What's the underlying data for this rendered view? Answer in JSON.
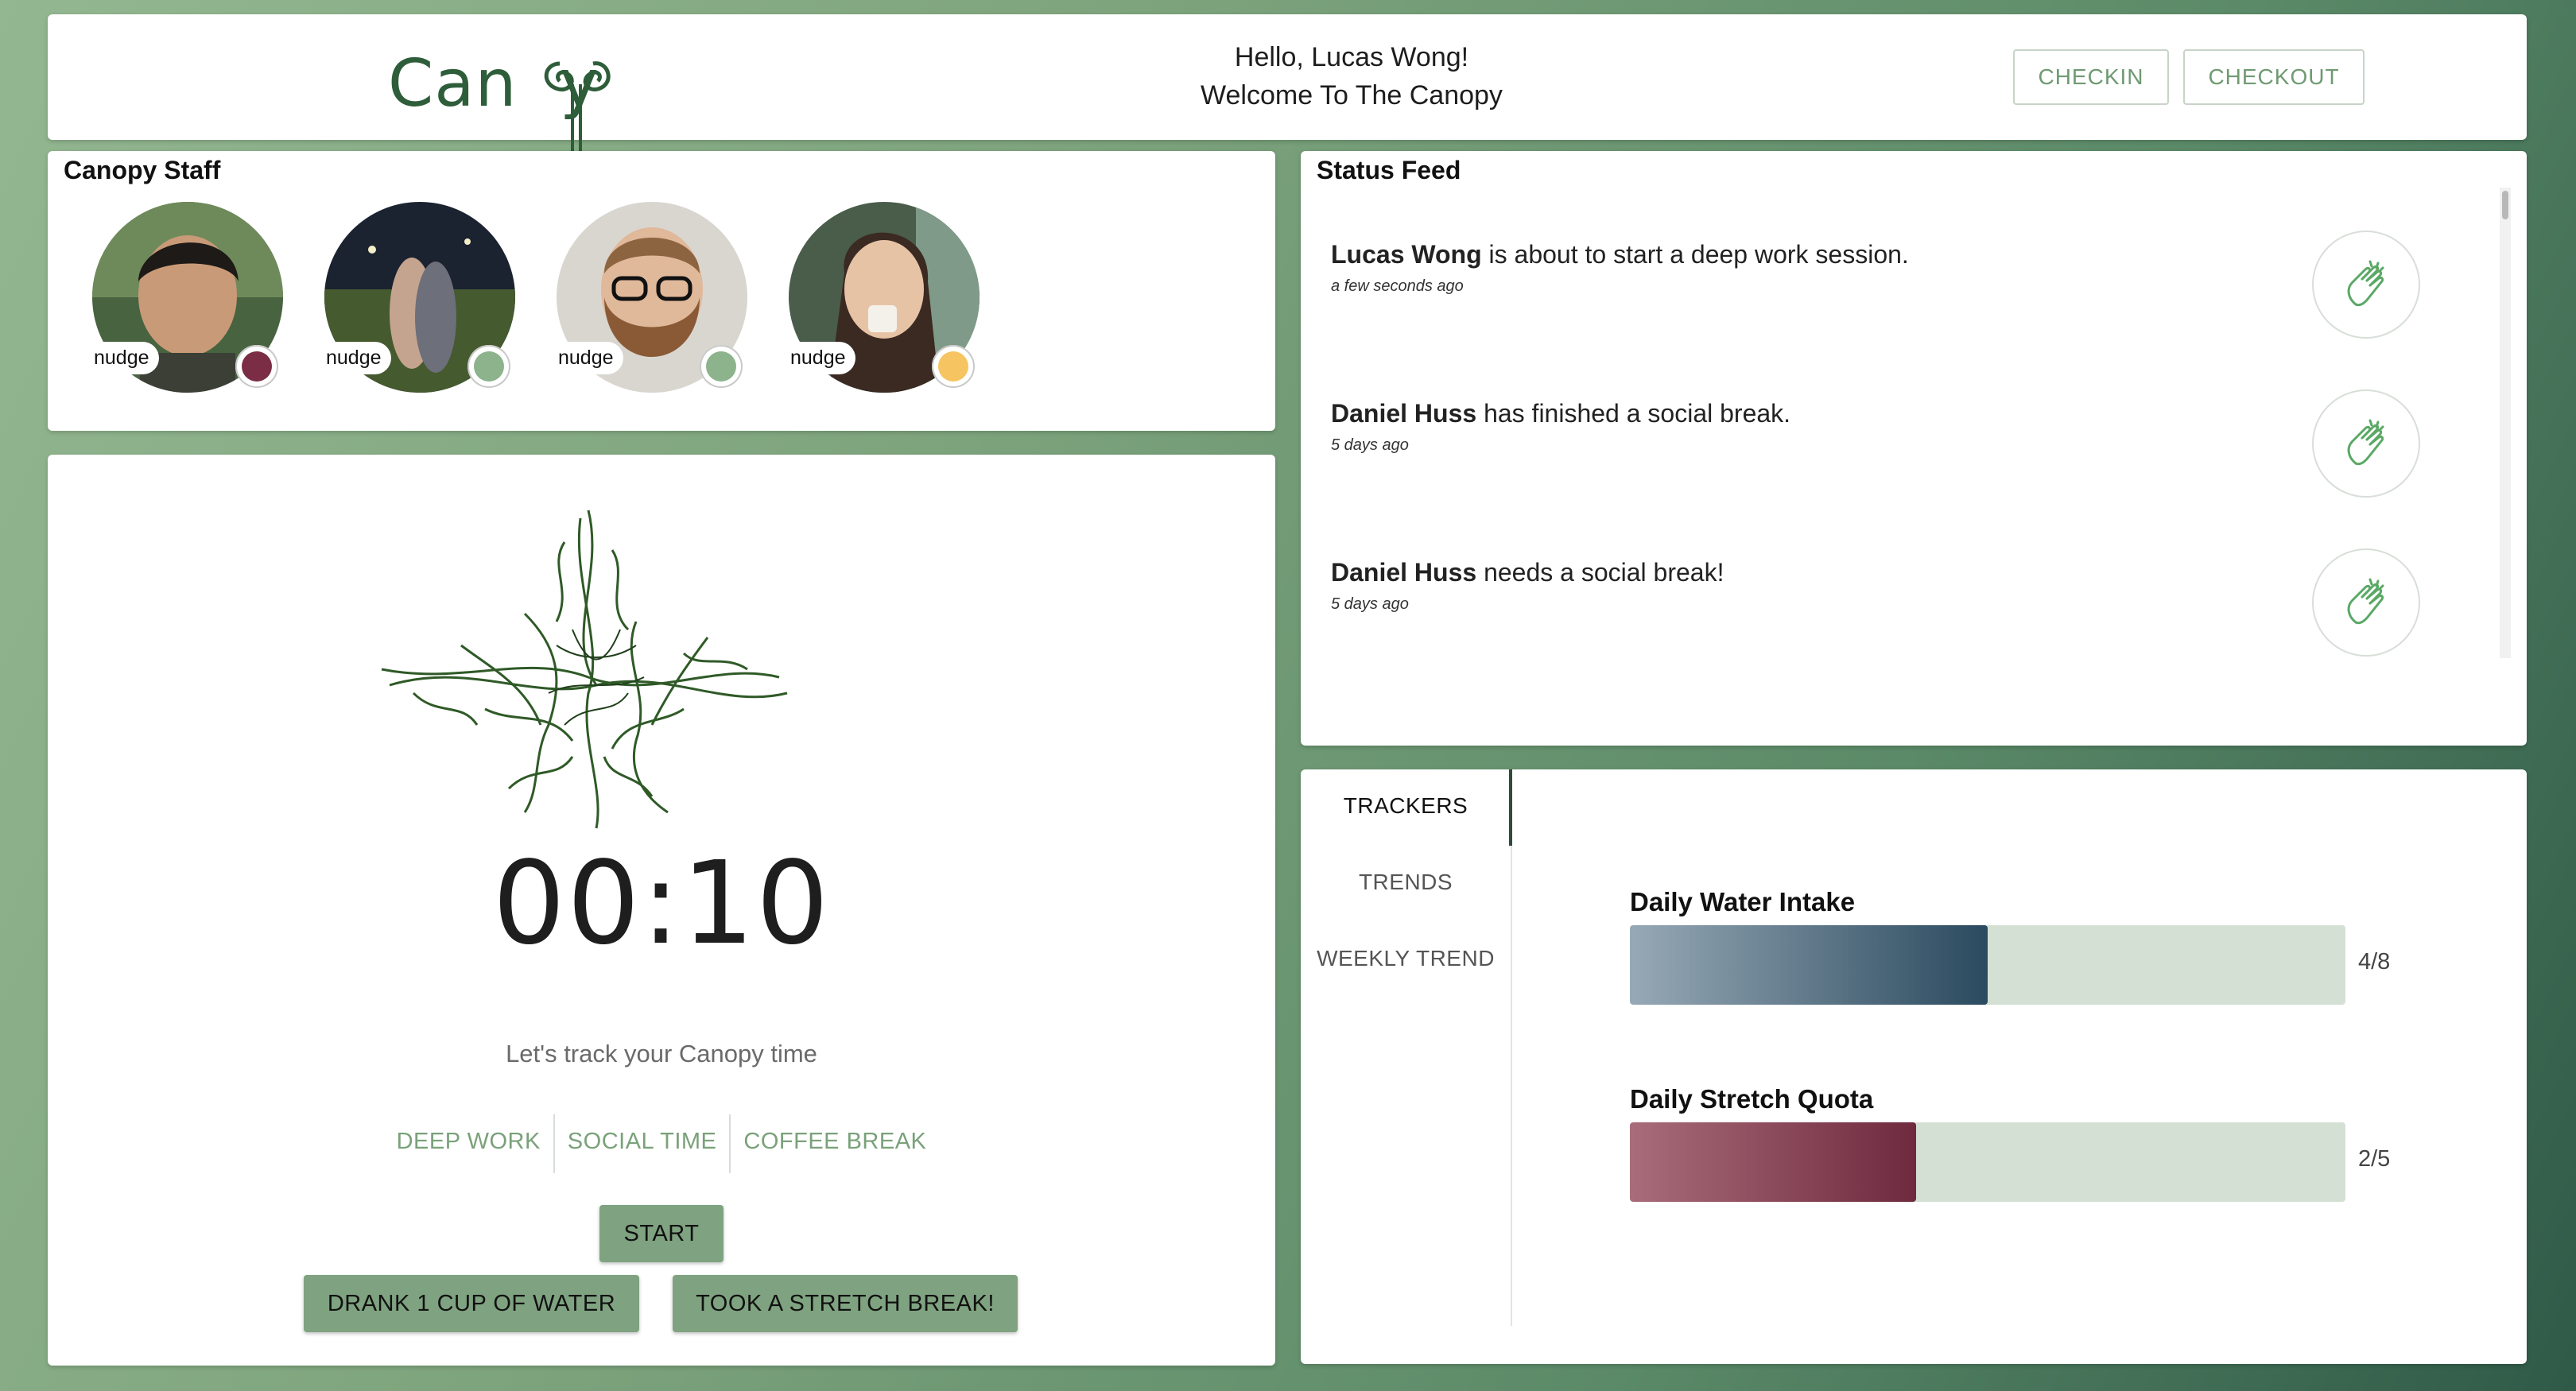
{
  "header": {
    "logo_left": "Can",
    "logo_right": "y",
    "greeting_line1": "Hello, Lucas Wong!",
    "greeting_line2": "Welcome To The Canopy",
    "checkin_label": "CHECKIN",
    "checkout_label": "CHECKOUT"
  },
  "staff": {
    "title": "Canopy Staff",
    "members": [
      {
        "nudge_label": "nudge",
        "status_color": "#7a2d44"
      },
      {
        "nudge_label": "nudge",
        "status_color": "#8cb38c"
      },
      {
        "nudge_label": "nudge",
        "status_color": "#8cb38c"
      },
      {
        "nudge_label": "nudge",
        "status_color": "#f6c460"
      }
    ]
  },
  "timer": {
    "time": "00:10",
    "prompt": "Let's track your Canopy time",
    "modes": [
      "DEEP WORK",
      "SOCIAL TIME",
      "COFFEE BREAK"
    ],
    "start_label": "START",
    "water_label": "DRANK 1 CUP OF WATER",
    "stretch_label": "TOOK A STRETCH BREAK!"
  },
  "feed": {
    "title": "Status Feed",
    "items": [
      {
        "name": "Lucas Wong",
        "text": " is about to start a deep work session.",
        "time": "a few seconds ago",
        "icon": "clap-icon"
      },
      {
        "name": "Daniel Huss",
        "text": " has finished a social break.",
        "time": "5 days ago",
        "icon": "clap-icon"
      },
      {
        "name": "Daniel Huss",
        "text": " needs a social break!",
        "time": "5 days ago",
        "icon": "clap-icon"
      }
    ]
  },
  "trackers": {
    "tabs": [
      "TRACKERS",
      "TRENDS",
      "WEEKLY TREND"
    ],
    "items": [
      {
        "label": "Daily Water Intake",
        "value_text": "4/8",
        "fraction": 0.5,
        "color_start": "#97a9b6",
        "color_end": "#2b4a5f"
      },
      {
        "label": "Daily Stretch Quota",
        "value_text": "2/5",
        "fraction": 0.4,
        "color_start": "#a86c7a",
        "color_end": "#6f2a3e"
      }
    ]
  }
}
